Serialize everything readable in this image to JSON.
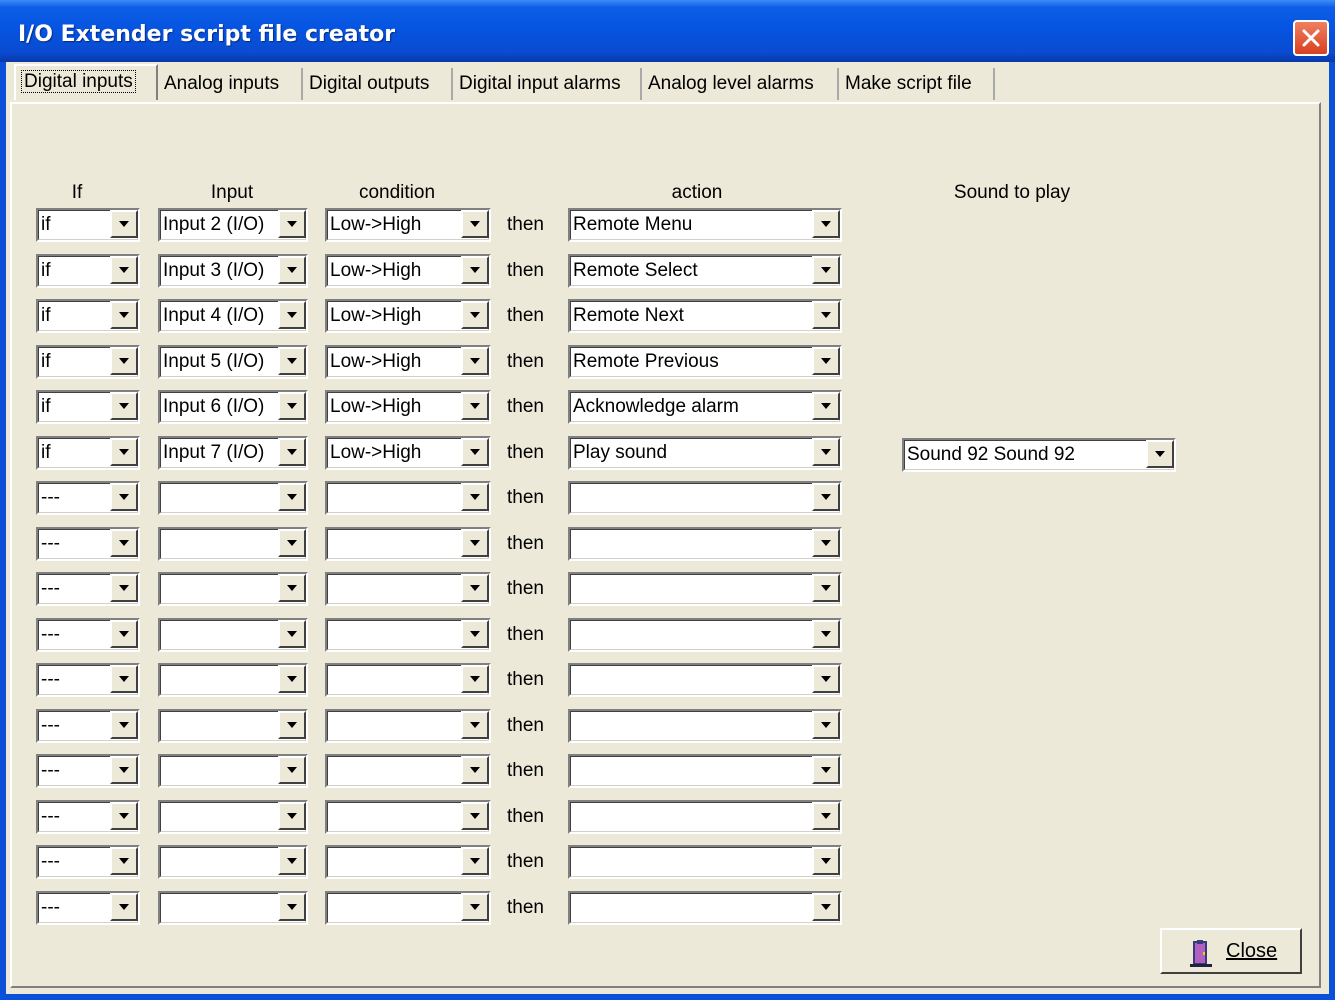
{
  "window": {
    "title": "I/O Extender script file creator"
  },
  "tabs": [
    {
      "label": "Digital inputs",
      "active": true
    },
    {
      "label": "Analog inputs",
      "active": false
    },
    {
      "label": "Digital outputs",
      "active": false
    },
    {
      "label": "Digital input alarms",
      "active": false
    },
    {
      "label": "Analog level alarms",
      "active": false
    },
    {
      "label": "Make script file",
      "active": false
    }
  ],
  "headers": {
    "if": "If",
    "input": "Input",
    "condition": "condition",
    "action": "action",
    "sound": "Sound to play"
  },
  "then_label": "then",
  "rows": [
    {
      "if": "if",
      "input": "Input 2 (I/O)",
      "condition": "Low->High",
      "action": "Remote Menu",
      "sound": ""
    },
    {
      "if": "if",
      "input": "Input 3 (I/O)",
      "condition": "Low->High",
      "action": "Remote Select",
      "sound": ""
    },
    {
      "if": "if",
      "input": "Input 4 (I/O)",
      "condition": "Low->High",
      "action": "Remote Next",
      "sound": ""
    },
    {
      "if": "if",
      "input": "Input 5 (I/O)",
      "condition": "Low->High",
      "action": "Remote Previous",
      "sound": ""
    },
    {
      "if": "if",
      "input": "Input 6 (I/O)",
      "condition": "Low->High",
      "action": "Acknowledge alarm",
      "sound": ""
    },
    {
      "if": "if",
      "input": "Input 7 (I/O)",
      "condition": "Low->High",
      "action": "Play sound",
      "sound": "Sound 92 Sound 92"
    },
    {
      "if": "---",
      "input": "",
      "condition": "",
      "action": "",
      "sound": ""
    },
    {
      "if": "---",
      "input": "",
      "condition": "",
      "action": "",
      "sound": ""
    },
    {
      "if": "---",
      "input": "",
      "condition": "",
      "action": "",
      "sound": ""
    },
    {
      "if": "---",
      "input": "",
      "condition": "",
      "action": "",
      "sound": ""
    },
    {
      "if": "---",
      "input": "",
      "condition": "",
      "action": "",
      "sound": ""
    },
    {
      "if": "---",
      "input": "",
      "condition": "",
      "action": "",
      "sound": ""
    },
    {
      "if": "---",
      "input": "",
      "condition": "",
      "action": "",
      "sound": ""
    },
    {
      "if": "---",
      "input": "",
      "condition": "",
      "action": "",
      "sound": ""
    },
    {
      "if": "---",
      "input": "",
      "condition": "",
      "action": "",
      "sound": ""
    },
    {
      "if": "---",
      "input": "",
      "condition": "",
      "action": "",
      "sound": ""
    }
  ],
  "buttons": {
    "close_label": "Close",
    "close_icon": "door-exit-icon"
  },
  "colors": {
    "titlebar": "#0553e0",
    "face": "#ece9d8",
    "close_x": "#e04a28"
  }
}
